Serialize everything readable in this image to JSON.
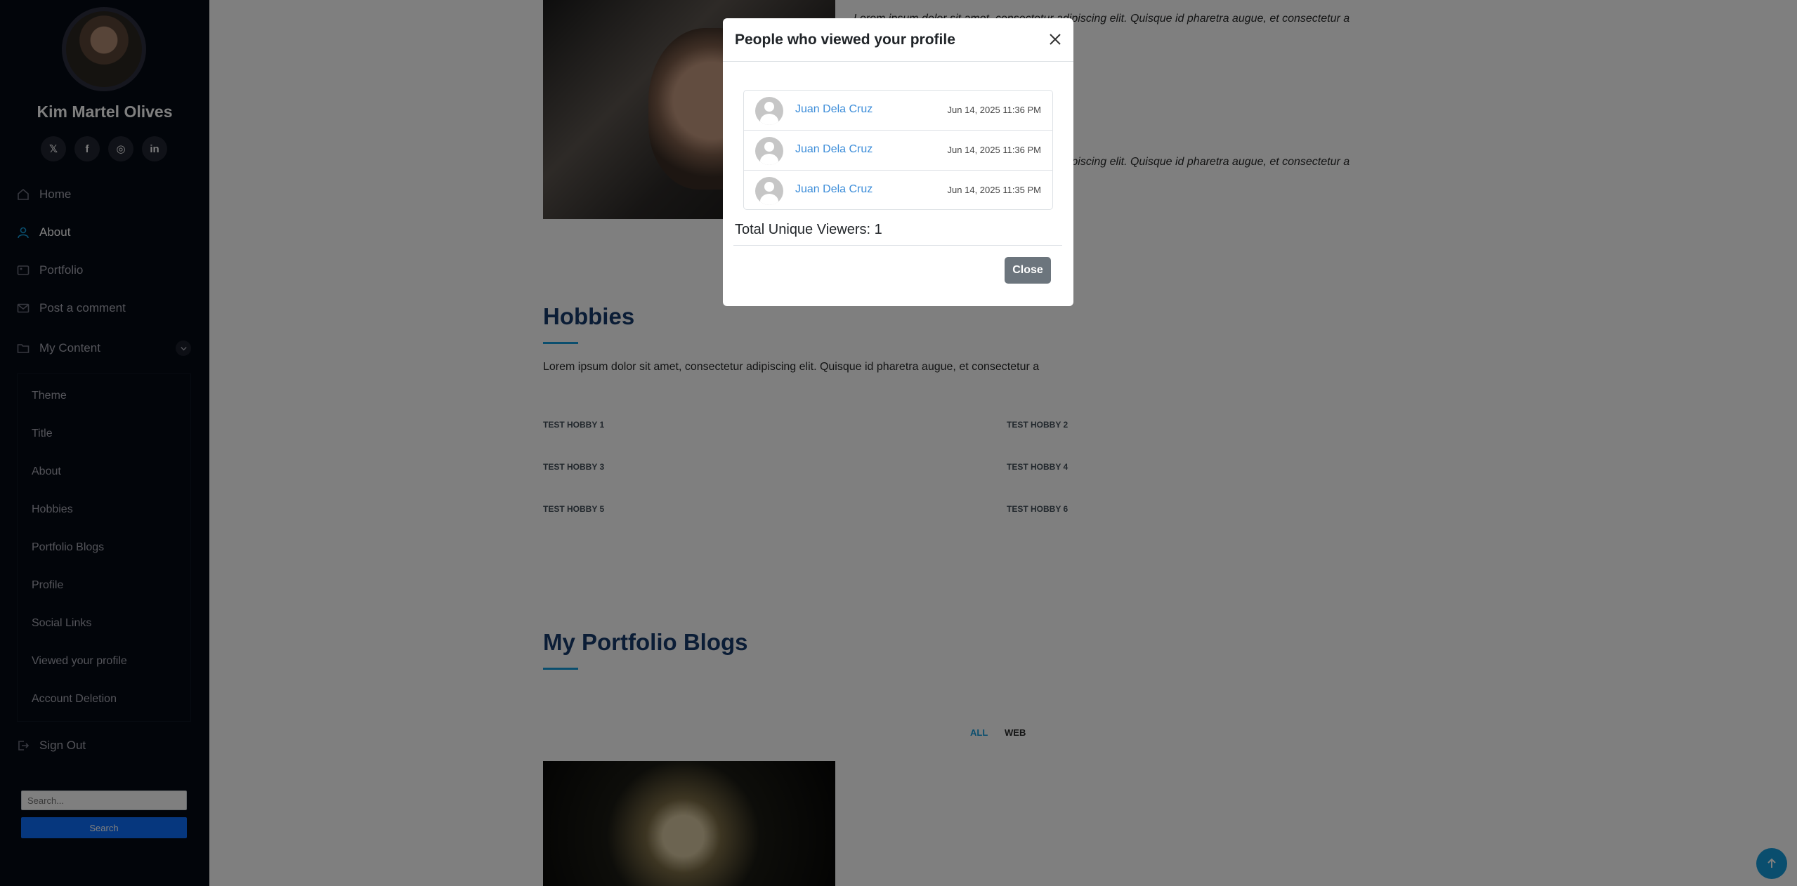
{
  "sidebar": {
    "name": "Kim Martel Olives",
    "social": [
      {
        "icon": "x-twitter-icon",
        "glyph": "𝕏"
      },
      {
        "icon": "facebook-icon",
        "glyph": "f"
      },
      {
        "icon": "instagram-icon",
        "glyph": "◎"
      },
      {
        "icon": "linkedin-icon",
        "glyph": "in"
      }
    ],
    "nav": {
      "home": "Home",
      "about": "About",
      "portfolio": "Portfolio",
      "post_comment": "Post a comment",
      "my_content": "My Content",
      "sign_out": "Sign Out"
    },
    "submenu": [
      "Theme",
      "Title",
      "About",
      "Hobbies",
      "Portfolio Blogs",
      "Profile",
      "Social Links",
      "Viewed your profile",
      "Account Deletion"
    ],
    "search": {
      "placeholder": "Search...",
      "button": "Search"
    }
  },
  "main": {
    "about_line_1": "Lorem ipsum dolor sit amet, consectetur adipiscing elit. Quisque id pharetra augue, et consectetur a",
    "about_line_2": "Lorem ipsum dolor sit amet, consectetur adipiscing elit. Quisque id pharetra augue, et consectetur a",
    "hobbies_title": "Hobbies",
    "hobbies_text": "Lorem ipsum dolor sit amet, consectetur adipiscing elit. Quisque id pharetra augue, et consectetur a",
    "hobbies": [
      "TEST HOBBY 1",
      "TEST HOBBY 2",
      "TEST HOBBY 3",
      "TEST HOBBY 4",
      "TEST HOBBY 5",
      "TEST HOBBY 6"
    ],
    "blogs_title": "My Portfolio Blogs",
    "filters": {
      "all": "ALL",
      "web": "WEB"
    }
  },
  "modal": {
    "title": "People who viewed your profile",
    "viewers": [
      {
        "name": "Juan Dela Cruz",
        "time": "Jun 14, 2025 11:36 PM"
      },
      {
        "name": "Juan Dela Cruz",
        "time": "Jun 14, 2025 11:36 PM"
      },
      {
        "name": "Juan Dela Cruz",
        "time": "Jun 14, 2025 11:35 PM"
      }
    ],
    "total": "Total Unique Viewers: 1",
    "close_button": "Close"
  },
  "colors": {
    "accent": "#149ddd",
    "sidebar_bg": "#040b14",
    "link": "#3c8dd9",
    "close_btn": "#6c757d"
  }
}
